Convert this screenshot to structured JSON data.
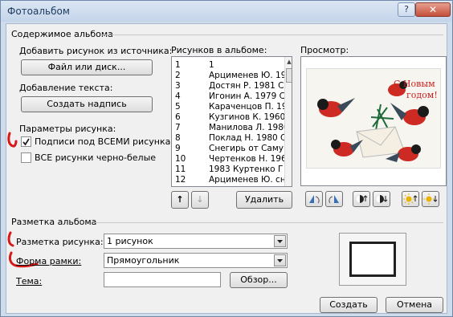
{
  "window": {
    "title": "Фотоальбом",
    "help_glyph": "?",
    "close_glyph": "✕"
  },
  "content_section": {
    "title": "Содержимое альбома",
    "insert_from_label": "Добавить рисунок из источника:",
    "file_button": "Файл или диск...",
    "insert_text_label": "Добавление текста:",
    "new_textbox_button": "Создать надпись",
    "picture_options_label": "Параметры рисунка:",
    "captions_checkbox": {
      "label": "Подписи под ВСЕМИ рисунками",
      "checked": true
    },
    "bw_checkbox": {
      "label": "ВСЕ рисунки черно-белые",
      "checked": false
    }
  },
  "pictures_list": {
    "label": "Рисунков в альбоме:",
    "items": [
      {
        "num": "1",
        "name": "1"
      },
      {
        "num": "2",
        "name": "Арцименев Ю. 19"
      },
      {
        "num": "3",
        "name": "Достян Р. 1981 С"
      },
      {
        "num": "4",
        "name": "Игонин А. 1979 С"
      },
      {
        "num": "5",
        "name": "Караченцов П. 19"
      },
      {
        "num": "6",
        "name": "Кузгинов К. 1960"
      },
      {
        "num": "7",
        "name": "Манилова Л. 1980"
      },
      {
        "num": "8",
        "name": "Поклад Н. 1980 С"
      },
      {
        "num": "9",
        "name": "Снегирь от Самуі"
      },
      {
        "num": "10",
        "name": "Чертенков Н. 196"
      },
      {
        "num": "11",
        "name": "1983 Куртенко Г"
      },
      {
        "num": "12",
        "name": "Арцименев Ю. сн"
      }
    ],
    "move_up_glyph": "↑",
    "move_down_glyph": "↓",
    "remove_button": "Удалить"
  },
  "preview": {
    "label": "Просмотр:",
    "card_text_line1": "С Новым",
    "card_text_line2": "годом!"
  },
  "layout_section": {
    "title": "Разметка альбома",
    "picture_layout_label": "Разметка рисунка:",
    "picture_layout_value": "1 рисунок",
    "frame_shape_label": "Форма рамки:",
    "frame_shape_value": "Прямоугольник",
    "theme_label": "Тема:",
    "theme_value": "",
    "browse_button": "Обзор..."
  },
  "footer": {
    "create_button": "Создать",
    "cancel_button": "Отмена"
  },
  "colors": {
    "accent_red": "#d81818",
    "card_text_red": "#cc1f1f",
    "title_blue": "#1e3a5f"
  }
}
